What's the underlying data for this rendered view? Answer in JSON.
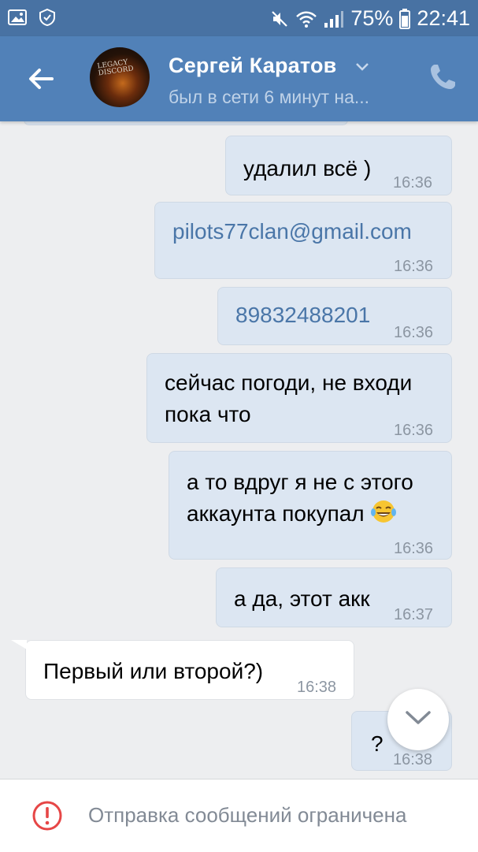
{
  "status_bar": {
    "battery": "75%",
    "time": "22:41",
    "icons": [
      "gallery-icon",
      "shield-icon",
      "mute-icon",
      "wifi-icon",
      "signal-icon",
      "battery-icon"
    ]
  },
  "header": {
    "back_icon": "back-arrow-icon",
    "avatar_text": "LEGACY DISCORD",
    "name": "Сергей Каратов",
    "status": "был в сети 6 минут на...",
    "call_icon": "phone-icon"
  },
  "messages": [
    {
      "dir": "out",
      "text": "удалил всё )",
      "time": "16:36"
    },
    {
      "dir": "out",
      "text": "pilots77clan@gmail.com",
      "time": "16:36"
    },
    {
      "dir": "out",
      "text": "89832488201",
      "time": "16:36"
    },
    {
      "dir": "out",
      "line1": "сейчас погоди, не входи",
      "line2": "пока что",
      "time": "16:36"
    },
    {
      "dir": "out",
      "line1": "а то вдруг я не с этого",
      "line2": "аккаунта покупал",
      "emoji": "tears-of-joy-emoji",
      "time": "16:36"
    },
    {
      "dir": "out",
      "text": "а да, этот акк",
      "time": "16:37"
    },
    {
      "dir": "in",
      "text": "Первый или второй?)",
      "time": "16:38"
    },
    {
      "dir": "out",
      "text": "?",
      "time": "16:38"
    }
  ],
  "scroll_button": {
    "icon": "chevron-down-icon"
  },
  "bottom_bar": {
    "icon": "warning-icon",
    "text": "Отправка сообщений ограничена",
    "accent": "#e64646"
  },
  "colors": {
    "status_bar": "#4872a3",
    "header": "#5181b8",
    "background": "#edeef0",
    "outgoing_bubble": "#dce6f2",
    "incoming_bubble": "#ffffff",
    "link": "#4a76a8"
  }
}
